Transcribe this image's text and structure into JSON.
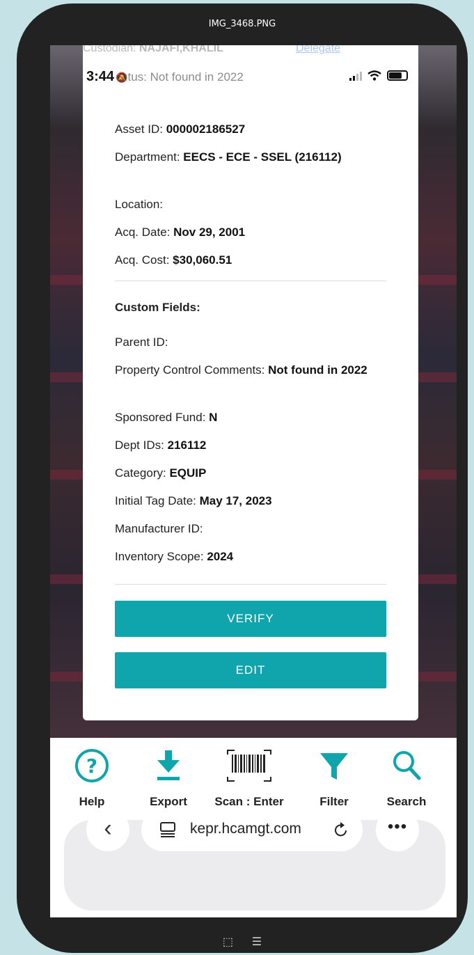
{
  "file_title": "IMG_3468.PNG",
  "status_bar": {
    "time": "3:44"
  },
  "header": {
    "custodian_label": "Custodian:",
    "custodian_value": "NAJAFI,KHALIL",
    "delegate_link": "Delegate",
    "status_text": "tus: Not found in 2022"
  },
  "fields": [
    {
      "label": "Asset ID:",
      "value": "000002186527"
    },
    {
      "label": "Department:",
      "value": "EECS - ECE - SSEL (216112)"
    },
    {
      "label": "Location:",
      "value": ""
    },
    {
      "label": "Acq. Date:",
      "value": "Nov 29, 2001"
    },
    {
      "label": "Acq. Cost:",
      "value": "$30,060.51"
    }
  ],
  "custom_fields_heading": "Custom Fields:",
  "custom_fields": [
    {
      "label": "Parent ID:",
      "value": ""
    },
    {
      "label": "Property Control Comments:",
      "value": "Not found in 2022"
    },
    {
      "label": "Sponsored Fund:",
      "value": "N"
    },
    {
      "label": "Dept IDs:",
      "value": "216112"
    },
    {
      "label": "Category:",
      "value": "EQUIP"
    },
    {
      "label": "Initial Tag Date:",
      "value": "May 17, 2023"
    },
    {
      "label": "Manufacturer ID:",
      "value": ""
    },
    {
      "label": "Inventory Scope:",
      "value": "2024"
    }
  ],
  "buttons": {
    "verify": "VERIFY",
    "edit": "EDIT"
  },
  "toolbar": {
    "help": "Help",
    "export": "Export",
    "scan": "Scan : Enter",
    "filter": "Filter",
    "search": "Search"
  },
  "browser": {
    "url": "kepr.hcamgt.com"
  },
  "colors": {
    "accent": "#10a4ad",
    "background": "#c5e3e6"
  }
}
